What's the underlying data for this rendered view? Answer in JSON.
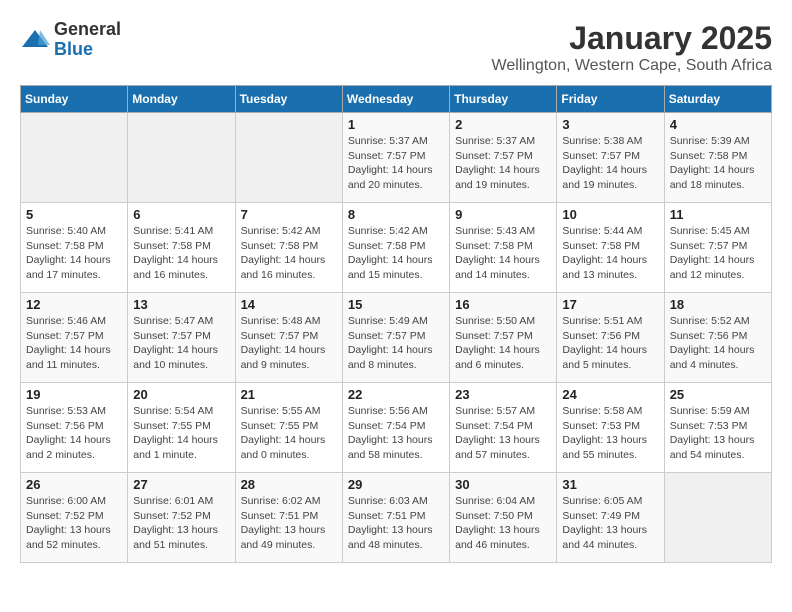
{
  "logo": {
    "general": "General",
    "blue": "Blue"
  },
  "title": "January 2025",
  "subtitle": "Wellington, Western Cape, South Africa",
  "days_of_week": [
    "Sunday",
    "Monday",
    "Tuesday",
    "Wednesday",
    "Thursday",
    "Friday",
    "Saturday"
  ],
  "weeks": [
    [
      {
        "day": "",
        "info": ""
      },
      {
        "day": "",
        "info": ""
      },
      {
        "day": "",
        "info": ""
      },
      {
        "day": "1",
        "info": "Sunrise: 5:37 AM\nSunset: 7:57 PM\nDaylight: 14 hours\nand 20 minutes."
      },
      {
        "day": "2",
        "info": "Sunrise: 5:37 AM\nSunset: 7:57 PM\nDaylight: 14 hours\nand 19 minutes."
      },
      {
        "day": "3",
        "info": "Sunrise: 5:38 AM\nSunset: 7:57 PM\nDaylight: 14 hours\nand 19 minutes."
      },
      {
        "day": "4",
        "info": "Sunrise: 5:39 AM\nSunset: 7:58 PM\nDaylight: 14 hours\nand 18 minutes."
      }
    ],
    [
      {
        "day": "5",
        "info": "Sunrise: 5:40 AM\nSunset: 7:58 PM\nDaylight: 14 hours\nand 17 minutes."
      },
      {
        "day": "6",
        "info": "Sunrise: 5:41 AM\nSunset: 7:58 PM\nDaylight: 14 hours\nand 16 minutes."
      },
      {
        "day": "7",
        "info": "Sunrise: 5:42 AM\nSunset: 7:58 PM\nDaylight: 14 hours\nand 16 minutes."
      },
      {
        "day": "8",
        "info": "Sunrise: 5:42 AM\nSunset: 7:58 PM\nDaylight: 14 hours\nand 15 minutes."
      },
      {
        "day": "9",
        "info": "Sunrise: 5:43 AM\nSunset: 7:58 PM\nDaylight: 14 hours\nand 14 minutes."
      },
      {
        "day": "10",
        "info": "Sunrise: 5:44 AM\nSunset: 7:58 PM\nDaylight: 14 hours\nand 13 minutes."
      },
      {
        "day": "11",
        "info": "Sunrise: 5:45 AM\nSunset: 7:57 PM\nDaylight: 14 hours\nand 12 minutes."
      }
    ],
    [
      {
        "day": "12",
        "info": "Sunrise: 5:46 AM\nSunset: 7:57 PM\nDaylight: 14 hours\nand 11 minutes."
      },
      {
        "day": "13",
        "info": "Sunrise: 5:47 AM\nSunset: 7:57 PM\nDaylight: 14 hours\nand 10 minutes."
      },
      {
        "day": "14",
        "info": "Sunrise: 5:48 AM\nSunset: 7:57 PM\nDaylight: 14 hours\nand 9 minutes."
      },
      {
        "day": "15",
        "info": "Sunrise: 5:49 AM\nSunset: 7:57 PM\nDaylight: 14 hours\nand 8 minutes."
      },
      {
        "day": "16",
        "info": "Sunrise: 5:50 AM\nSunset: 7:57 PM\nDaylight: 14 hours\nand 6 minutes."
      },
      {
        "day": "17",
        "info": "Sunrise: 5:51 AM\nSunset: 7:56 PM\nDaylight: 14 hours\nand 5 minutes."
      },
      {
        "day": "18",
        "info": "Sunrise: 5:52 AM\nSunset: 7:56 PM\nDaylight: 14 hours\nand 4 minutes."
      }
    ],
    [
      {
        "day": "19",
        "info": "Sunrise: 5:53 AM\nSunset: 7:56 PM\nDaylight: 14 hours\nand 2 minutes."
      },
      {
        "day": "20",
        "info": "Sunrise: 5:54 AM\nSunset: 7:55 PM\nDaylight: 14 hours\nand 1 minute."
      },
      {
        "day": "21",
        "info": "Sunrise: 5:55 AM\nSunset: 7:55 PM\nDaylight: 14 hours\nand 0 minutes."
      },
      {
        "day": "22",
        "info": "Sunrise: 5:56 AM\nSunset: 7:54 PM\nDaylight: 13 hours\nand 58 minutes."
      },
      {
        "day": "23",
        "info": "Sunrise: 5:57 AM\nSunset: 7:54 PM\nDaylight: 13 hours\nand 57 minutes."
      },
      {
        "day": "24",
        "info": "Sunrise: 5:58 AM\nSunset: 7:53 PM\nDaylight: 13 hours\nand 55 minutes."
      },
      {
        "day": "25",
        "info": "Sunrise: 5:59 AM\nSunset: 7:53 PM\nDaylight: 13 hours\nand 54 minutes."
      }
    ],
    [
      {
        "day": "26",
        "info": "Sunrise: 6:00 AM\nSunset: 7:52 PM\nDaylight: 13 hours\nand 52 minutes."
      },
      {
        "day": "27",
        "info": "Sunrise: 6:01 AM\nSunset: 7:52 PM\nDaylight: 13 hours\nand 51 minutes."
      },
      {
        "day": "28",
        "info": "Sunrise: 6:02 AM\nSunset: 7:51 PM\nDaylight: 13 hours\nand 49 minutes."
      },
      {
        "day": "29",
        "info": "Sunrise: 6:03 AM\nSunset: 7:51 PM\nDaylight: 13 hours\nand 48 minutes."
      },
      {
        "day": "30",
        "info": "Sunrise: 6:04 AM\nSunset: 7:50 PM\nDaylight: 13 hours\nand 46 minutes."
      },
      {
        "day": "31",
        "info": "Sunrise: 6:05 AM\nSunset: 7:49 PM\nDaylight: 13 hours\nand 44 minutes."
      },
      {
        "day": "",
        "info": ""
      }
    ]
  ]
}
